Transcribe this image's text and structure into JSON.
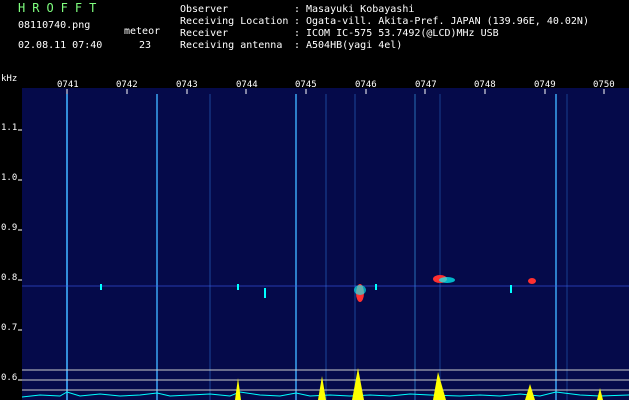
{
  "header": {
    "logo": "HROFFT",
    "filename": "08110740.png",
    "event_type": "meteor",
    "datetime": "02.08.11 07:40",
    "count": "23"
  },
  "meta": [
    {
      "label": "Observer",
      "value": "Masayuki Kobayashi"
    },
    {
      "label": "Receiving Location",
      "value": "Ogata-vill. Akita-Pref. JAPAN (139.96E, 40.02N)"
    },
    {
      "label": "Receiver",
      "value": "ICOM IC-575 53.7492(@LCD)MHz USB"
    },
    {
      "label": "Receiving antenna",
      "value": "A504HB(yagi 4el)"
    }
  ],
  "axis": {
    "unit": "kHz",
    "y_ticks": [
      "1.1",
      "1.0",
      "0.9",
      "0.8",
      "0.7",
      "0.6"
    ],
    "x_ticks": [
      "0741",
      "0742",
      "0743",
      "0744",
      "0745",
      "0746",
      "0747",
      "0748",
      "0749",
      "0750"
    ]
  },
  "colors": {
    "background": "#050a4a",
    "text": "#ffffff",
    "logo": "#7fff7f",
    "signal_cyan": "#00ffff",
    "signal_yellow": "#ffff00",
    "signal_red": "#ff3030"
  }
}
